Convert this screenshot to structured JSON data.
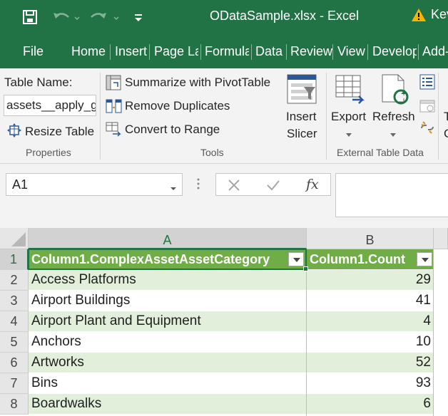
{
  "window": {
    "title": "ODataSample.xlsx  -  Excel",
    "user": "Kev"
  },
  "tabs": [
    "File",
    "Home",
    "Insert",
    "Page La",
    "Formula",
    "Data",
    "Review",
    "View",
    "Develop",
    "Add-"
  ],
  "ribbon": {
    "properties": {
      "table_name_label": "Table Name:",
      "table_name_value": "assets__apply_gr",
      "resize_label": "Resize Table",
      "group_label": "Properties"
    },
    "tools": {
      "summarize_label": "Summarize with PivotTable",
      "remove_dup_label": "Remove Duplicates",
      "convert_label": "Convert to Range",
      "group_label": "Tools"
    },
    "insert_slicer": {
      "line1": "Insert",
      "line2": "Slicer"
    },
    "external": {
      "export_label": "Export",
      "refresh_label": "Refresh",
      "group_label": "External Table Data"
    },
    "overflow": {
      "line1": "T",
      "line2": "C"
    }
  },
  "formula_bar": {
    "name_box": "A1",
    "formula": ""
  },
  "grid": {
    "columns": [
      "A",
      "B"
    ],
    "headers": [
      "Column1.ComplexAssetAssetCategory",
      "Column1.Count"
    ],
    "rows": [
      {
        "num": "1"
      },
      {
        "num": "2",
        "category": "Access Platforms",
        "count": "29"
      },
      {
        "num": "3",
        "category": "Airport Buildings",
        "count": "41"
      },
      {
        "num": "4",
        "category": "Airport Plant and Equipment",
        "count": "4"
      },
      {
        "num": "5",
        "category": "Anchors",
        "count": "10"
      },
      {
        "num": "6",
        "category": "Artworks",
        "count": "52"
      },
      {
        "num": "7",
        "category": "Bins",
        "count": "93"
      },
      {
        "num": "8",
        "category": "Boardwalks",
        "count": "6"
      }
    ]
  },
  "colors": {
    "excel_green": "#217346",
    "table_header": "#70ad47",
    "band": "#e2efda"
  }
}
